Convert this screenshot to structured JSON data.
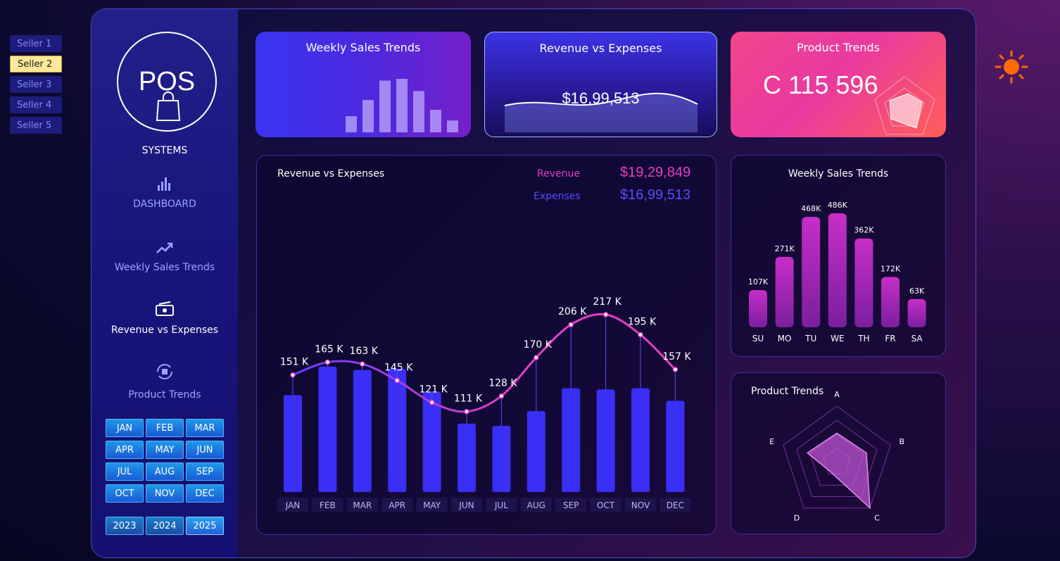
{
  "sellers": [
    "Seller 1",
    "Seller 2",
    "Seller 3",
    "Seller 4",
    "Seller 5"
  ],
  "active_seller_index": 1,
  "logo": {
    "text": "POS",
    "subtitle": "SYSTEMS"
  },
  "nav": [
    {
      "label": "DASHBOARD",
      "icon": "bar-chart-icon"
    },
    {
      "label": "Weekly Sales Trends",
      "icon": "trend-up-icon"
    },
    {
      "label": "Revenue vs Expenses",
      "icon": "cash-icon"
    },
    {
      "label": "Product Trends",
      "icon": "box-cycle-icon"
    }
  ],
  "active_nav_index": 2,
  "months": [
    "JAN",
    "FEB",
    "MAR",
    "APR",
    "MAY",
    "JUN",
    "JUL",
    "AUG",
    "SEP",
    "OCT",
    "NOV",
    "DEC"
  ],
  "years": [
    "2023",
    "2024",
    "2025"
  ],
  "active_year_index": 2,
  "cards": {
    "weekly": {
      "title": "Weekly Sales Trends"
    },
    "revenue": {
      "title": "Revenue vs Expenses",
      "value": "$16,99,513"
    },
    "product": {
      "title": "Product Trends",
      "value": "C  115 596"
    }
  },
  "main_panel": {
    "title": "Revenue vs Expenses",
    "revenue_label": "Revenue",
    "revenue_value": "$19,29,849",
    "expenses_label": "Expenses",
    "expenses_value": "$16,99,513"
  },
  "weekly_panel": {
    "title": "Weekly Sales Trends"
  },
  "product_panel": {
    "title": "Product Trends"
  },
  "colors": {
    "revenue": "#e63ec4",
    "expenses": "#5a4cff",
    "bar": "#3a2ff5"
  },
  "chart_data": [
    {
      "type": "bar",
      "title": "Revenue vs Expenses",
      "categories": [
        "JAN",
        "FEB",
        "MAR",
        "APR",
        "MAY",
        "JUN",
        "JUL",
        "AUG",
        "SEP",
        "OCT",
        "NOV",
        "DEC"
      ],
      "series": [
        {
          "name": "Expenses",
          "type": "bar",
          "values": [
            145,
            170,
            167,
            168,
            148,
            120,
            118,
            131,
            151,
            150,
            151,
            140
          ]
        },
        {
          "name": "Revenue",
          "type": "line",
          "values": [
            151,
            165,
            163,
            145,
            121,
            111,
            128,
            170,
            206,
            217,
            195,
            157
          ],
          "labels": [
            "151 K",
            "165 K",
            "163 K",
            "145 K",
            "121 K",
            "111 K",
            "128 K",
            "170 K",
            "206 K",
            "217 K",
            "195 K",
            "157 K"
          ]
        }
      ]
    },
    {
      "type": "bar",
      "title": "Weekly Sales Trends",
      "categories": [
        "SU",
        "MO",
        "TU",
        "WE",
        "TH",
        "FR",
        "SA"
      ],
      "values": [
        107,
        271,
        468,
        486,
        362,
        172,
        63
      ],
      "labels": [
        "107K",
        "271K",
        "468K",
        "486K",
        "362K",
        "172K",
        "63K"
      ]
    },
    {
      "type": "radar",
      "title": "Product Trends",
      "categories": [
        "A",
        "B",
        "C",
        "D",
        "E"
      ],
      "values": [
        0.52,
        0.55,
        1.0,
        0.2,
        0.55
      ],
      "max": 1
    }
  ]
}
